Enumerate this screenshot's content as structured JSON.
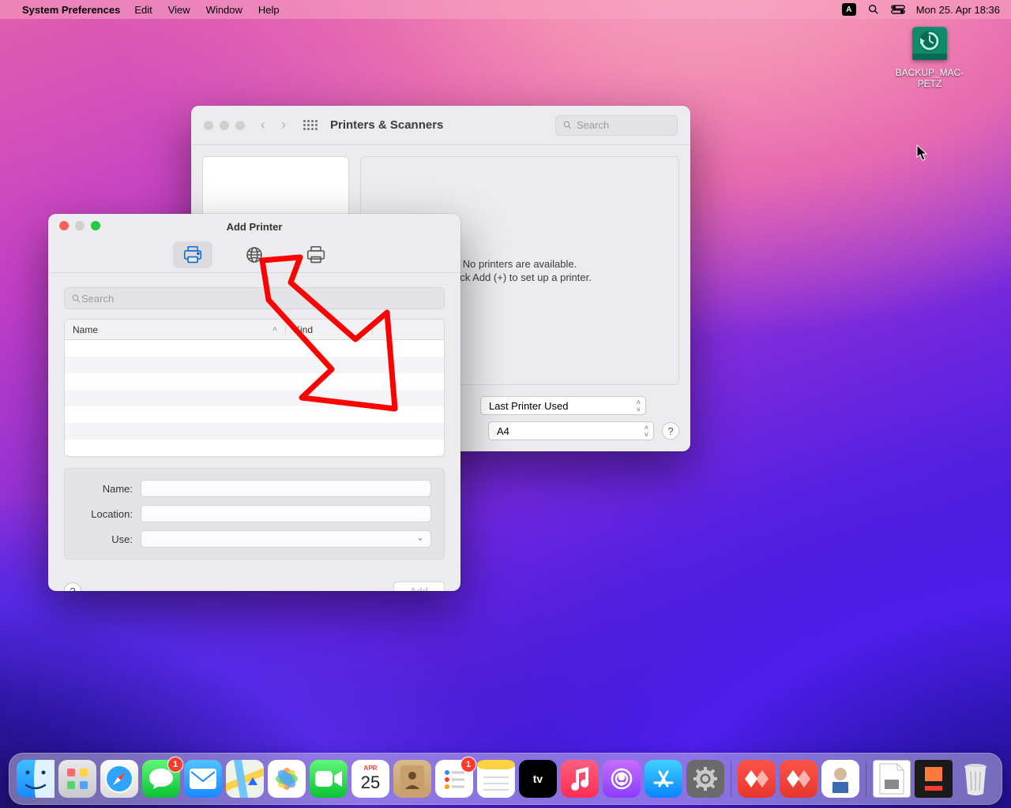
{
  "menubar": {
    "app": "System Preferences",
    "items": [
      "Edit",
      "View",
      "Window",
      "Help"
    ],
    "a_indicator": "A",
    "datetime": "Mon 25. Apr  18:36"
  },
  "desktop": {
    "drive_label": "BACKUP_MAC-PETZ"
  },
  "printers_window": {
    "title": "Printers & Scanners",
    "search_placeholder": "Search",
    "empty_line1": "No printers are available.",
    "empty_line2": "Click Add (+) to set up a printer.",
    "default_printer_value": "Last Printer Used",
    "paper_size_value": "A4",
    "help": "?"
  },
  "add_printer_window": {
    "title": "Add Printer",
    "search_placeholder": "Search",
    "columns": {
      "name": "Name",
      "kind": "Kind"
    },
    "form": {
      "name_label": "Name:",
      "location_label": "Location:",
      "use_label": "Use:"
    },
    "help": "?",
    "add_button": "Add"
  },
  "dock": {
    "calendar_month": "APR",
    "calendar_day": "25",
    "messages_badge": "1",
    "reminders_badge": "1"
  }
}
